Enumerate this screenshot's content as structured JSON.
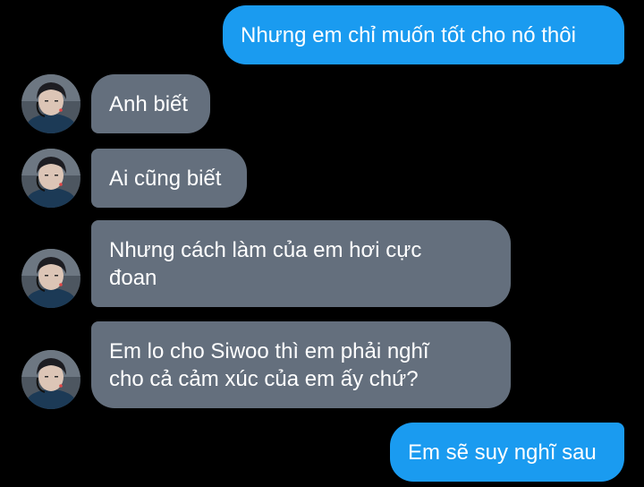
{
  "colors": {
    "background": "#000000",
    "sent_bubble": "#1a9bf0",
    "received_bubble": "#646f7d",
    "text": "#ffffff"
  },
  "messages": [
    {
      "sender": "me",
      "text": "Nhưng em chỉ muốn tốt cho nó thôi"
    },
    {
      "sender": "other",
      "text": "Anh biết"
    },
    {
      "sender": "other",
      "text": "Ai cũng biết"
    },
    {
      "sender": "other",
      "text": "Nhưng cách làm của em hơi cực\nđoan"
    },
    {
      "sender": "other",
      "text": "Em lo cho Siwoo thì em phải nghĩ\ncho cả cảm xúc của em ấy chứ?"
    },
    {
      "sender": "me",
      "text": "Em sẽ suy nghĩ sau"
    }
  ],
  "avatar_icon": "profile-photo-icon"
}
